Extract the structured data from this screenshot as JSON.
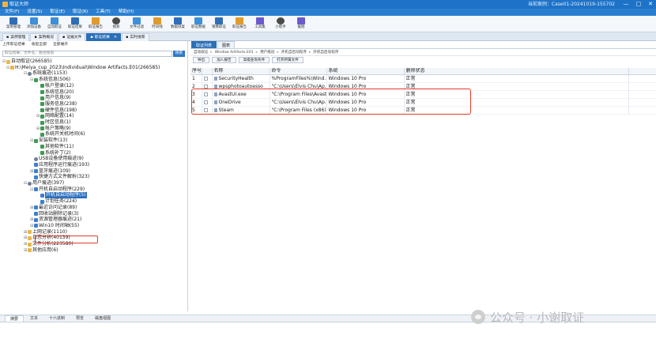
{
  "window": {
    "title": "取证大师",
    "case_label": "当前案例：Case01-20241019-155702",
    "buttons": [
      "—",
      "□",
      "✕"
    ]
  },
  "menu": [
    "文件(F)",
    "设置(S)",
    "取证(E)",
    "取证(R)",
    "工具(T)",
    "帮助(H)"
  ],
  "toolbar": [
    {
      "label": "案例管理",
      "icon": "case-manage-icon"
    },
    {
      "label": "添加设备",
      "icon": "add-device-icon"
    },
    {
      "label": "自动取证",
      "icon": "auto-forensics-icon"
    },
    {
      "label": "取证结果",
      "icon": "forensics-results-icon"
    },
    {
      "label": "取证报告",
      "icon": "report-icon"
    },
    {
      "label": "搜索",
      "icon": "search-icon"
    },
    {
      "label": "文件过滤",
      "icon": "file-filter-icon"
    },
    {
      "label": "时间线",
      "icon": "timeline-icon"
    },
    {
      "label": "数据恢复",
      "icon": "data-recovery-icon"
    },
    {
      "label": "取证数据",
      "icon": "data-icon"
    },
    {
      "label": "镜像取证",
      "icon": "image-forensics-icon"
    },
    {
      "label": "取证报告",
      "icon": "report2-icon"
    },
    {
      "label": "工具集",
      "icon": "toolkit-icon"
    },
    {
      "label": "小帮手",
      "icon": "helper-icon"
    },
    {
      "label": "截图",
      "icon": "screenshot-icon"
    }
  ],
  "doc_tabs": [
    {
      "label": "案例管理",
      "active": false
    },
    {
      "label": "案例概况",
      "active": false
    },
    {
      "label": "证据文件",
      "active": false
    },
    {
      "label": "取证结果",
      "active": true
    },
    {
      "label": "实时搜索",
      "active": false
    }
  ],
  "left": {
    "tools": [
      "上传取证结果",
      "收起全部",
      "全部展开"
    ],
    "search_placeholder": "取证结果、文件名、路径搜索",
    "search_button": "搜索",
    "tree": [
      {
        "label": "自动取证(266585)",
        "level": 0,
        "icon": "fold",
        "exp": "⊟"
      },
      {
        "label": "H:\\Meiya_cup_2023\\Individual\\Window Artifacts.E01(266585)",
        "level": 1,
        "icon": "fold",
        "exp": "⊟"
      },
      {
        "label": "系统痕迹(1153)",
        "level": 2,
        "icon": "gear",
        "exp": "⊟"
      },
      {
        "label": "系统信息(506)",
        "level": 3,
        "icon": "leaf",
        "exp": "⊟"
      },
      {
        "label": "帐户登录(12)",
        "level": 4,
        "icon": "leaf",
        "exp": ""
      },
      {
        "label": "系统信息(20)",
        "level": 4,
        "icon": "leaf",
        "exp": ""
      },
      {
        "label": "用户信息(9)",
        "level": 4,
        "icon": "leaf",
        "exp": ""
      },
      {
        "label": "服务信息(238)",
        "level": 4,
        "icon": "leaf",
        "exp": ""
      },
      {
        "label": "硬件信息(198)",
        "level": 4,
        "icon": "leaf",
        "exp": ""
      },
      {
        "label": "网络配置(14)",
        "level": 4,
        "icon": "leaf",
        "exp": "⊞"
      },
      {
        "label": "时区信息(1)",
        "level": 4,
        "icon": "leaf",
        "exp": ""
      },
      {
        "label": "帐户策略(9)",
        "level": 4,
        "icon": "leaf",
        "exp": "⊞"
      },
      {
        "label": "系统开关机时间(6)",
        "level": 4,
        "icon": "leaf",
        "exp": ""
      },
      {
        "label": "安装软件(13)",
        "level": 3,
        "icon": "leaf",
        "exp": "⊟"
      },
      {
        "label": "其他软件(11)",
        "level": 4,
        "icon": "leaf",
        "exp": ""
      },
      {
        "label": "系统补丁(2)",
        "level": 4,
        "icon": "leaf",
        "exp": ""
      },
      {
        "label": "USB设备使用痕迹(9)",
        "level": 3,
        "icon": "gear",
        "exp": ""
      },
      {
        "label": "应用程序运行痕迹(193)",
        "level": 3,
        "icon": "blue",
        "exp": ""
      },
      {
        "label": "蓝牙痕迹(109)",
        "level": 3,
        "icon": "blue",
        "exp": "⊞"
      },
      {
        "label": "快捷方式文件解析(323)",
        "level": 3,
        "icon": "blue",
        "exp": ""
      },
      {
        "label": "用户痕迹(397)",
        "level": 2,
        "icon": "gear",
        "exp": "⊟"
      },
      {
        "label": "开机自启动程序(229)",
        "level": 3,
        "icon": "blue",
        "exp": "⊟"
      },
      {
        "label": "开机自启动程序(5)",
        "level": 4,
        "icon": "blue",
        "exp": "",
        "selected": true
      },
      {
        "label": "计划任务(224)",
        "level": 4,
        "icon": "blue",
        "exp": ""
      },
      {
        "label": "最近访问记录(89)",
        "level": 3,
        "icon": "blue",
        "exp": "⊞"
      },
      {
        "label": "回收站删除记录(3)",
        "level": 3,
        "icon": "blue",
        "exp": ""
      },
      {
        "label": "资源管理器痕迹(21)",
        "level": 3,
        "icon": "blue",
        "exp": "⊞"
      },
      {
        "label": "Win10 时间轴(55)",
        "level": 3,
        "icon": "blue",
        "exp": "⊞"
      },
      {
        "label": "上网记录(1110)",
        "level": 2,
        "icon": "fold",
        "exp": "⊞"
      },
      {
        "label": "日志分析(40139)",
        "level": 2,
        "icon": "fold",
        "exp": "⊞"
      },
      {
        "label": "文件分析(223580)",
        "level": 2,
        "icon": "fold",
        "exp": "⊞"
      },
      {
        "label": "其他应用(6)",
        "level": 2,
        "icon": "fold",
        "exp": "⊞"
      }
    ]
  },
  "right": {
    "tabs": [
      {
        "label": "取证列表",
        "active": true
      },
      {
        "label": "图表",
        "active": false
      }
    ],
    "breadcrumb": [
      "自动取证",
      "Window Artifacts.E01",
      "用户痕迹",
      "开机自启动程序",
      "开机自启动程序"
    ],
    "buttons": [
      "导出",
      "加入报告",
      "高级查询条件",
      "打开所属文件"
    ],
    "columns": [
      "序号",
      "",
      "名称",
      "命令",
      "系统",
      "删除状态"
    ],
    "rows": [
      {
        "idx": "1",
        "name": "SecurityHealth",
        "cmd": "%ProgramFiles%\\Wind...",
        "sys": "Windows 10 Pro",
        "status": "正常"
      },
      {
        "idx": "2",
        "name": "wpsphotoautoasso",
        "cmd": "\"C:\\Users\\Elvis Chu\\Ap...",
        "sys": "Windows 10 Pro",
        "status": "正常"
      },
      {
        "idx": "3",
        "name": "AvastUI.exe",
        "cmd": "\"C:\\Program Files\\Avast ...",
        "sys": "Windows 10 Pro",
        "status": "正常"
      },
      {
        "idx": "4",
        "name": "OneDrive",
        "cmd": "\"C:\\Users\\Elvis Chu\\Ap...",
        "sys": "Windows 10 Pro",
        "status": "正常"
      },
      {
        "idx": "5",
        "name": "Steam",
        "cmd": "\"C:\\Program Files (x86)...",
        "sys": "Windows 10 Pro",
        "status": "正常"
      }
    ]
  },
  "bottom_tabs": [
    {
      "label": "摘要",
      "active": true
    },
    {
      "label": "文本",
      "active": false
    },
    {
      "label": "十六进制",
      "active": false
    },
    {
      "label": "预览",
      "active": false
    },
    {
      "label": "磁盘视图",
      "active": false
    }
  ],
  "watermark": "公众号 · 小谢取证",
  "colors": {
    "titlebar": "#1e73c8",
    "accent": "#2b6fb6",
    "highlight_box": "#e23a2a"
  }
}
